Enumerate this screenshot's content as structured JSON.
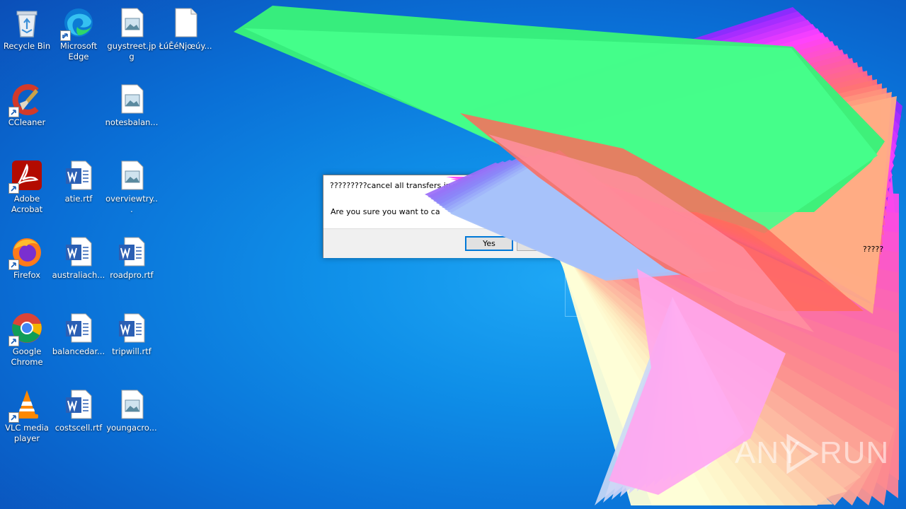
{
  "desktop_icons": [
    {
      "label": "Recycle Bin",
      "icon": "recycle-bin-icon"
    },
    {
      "label": "Microsoft Edge",
      "icon": "edge-icon"
    },
    {
      "label": "guystreet.jpg",
      "icon": "image-file-icon"
    },
    {
      "label": "ŁúĚéNjœúy...",
      "icon": "blank-file-icon"
    },
    {
      "label": "CCleaner",
      "icon": "ccleaner-icon"
    },
    {
      "label": "notesbalan...",
      "icon": "image-file-icon"
    },
    {
      "label": "Adobe Acrobat",
      "icon": "acrobat-icon"
    },
    {
      "label": "atie.rtf",
      "icon": "word-doc-icon"
    },
    {
      "label": "overviewtry...",
      "icon": "image-file-icon"
    },
    {
      "label": "Firefox",
      "icon": "firefox-icon"
    },
    {
      "label": "australiach...",
      "icon": "word-doc-icon"
    },
    {
      "label": "roadpro.rtf",
      "icon": "word-doc-icon"
    },
    {
      "label": "Google Chrome",
      "icon": "chrome-icon"
    },
    {
      "label": "balancedar...",
      "icon": "word-doc-icon"
    },
    {
      "label": "tripwill.rtf",
      "icon": "word-doc-icon"
    },
    {
      "label": "VLC media player",
      "icon": "vlc-icon"
    },
    {
      "label": "costscell.rtf",
      "icon": "word-doc-icon"
    },
    {
      "label": "youngacro...",
      "icon": "image-file-icon"
    }
  ],
  "dialog": {
    "title": "?????????cancel all transfers in w",
    "message": "Are you sure you want to ca",
    "yes_label": "Yes",
    "no_label": ""
  },
  "stray_text": "?????",
  "watermark": {
    "left": "ANY",
    "right": "RUN"
  },
  "colors": {
    "desktop": "#0f8fe8",
    "dialog_accent": "#0078d7"
  }
}
